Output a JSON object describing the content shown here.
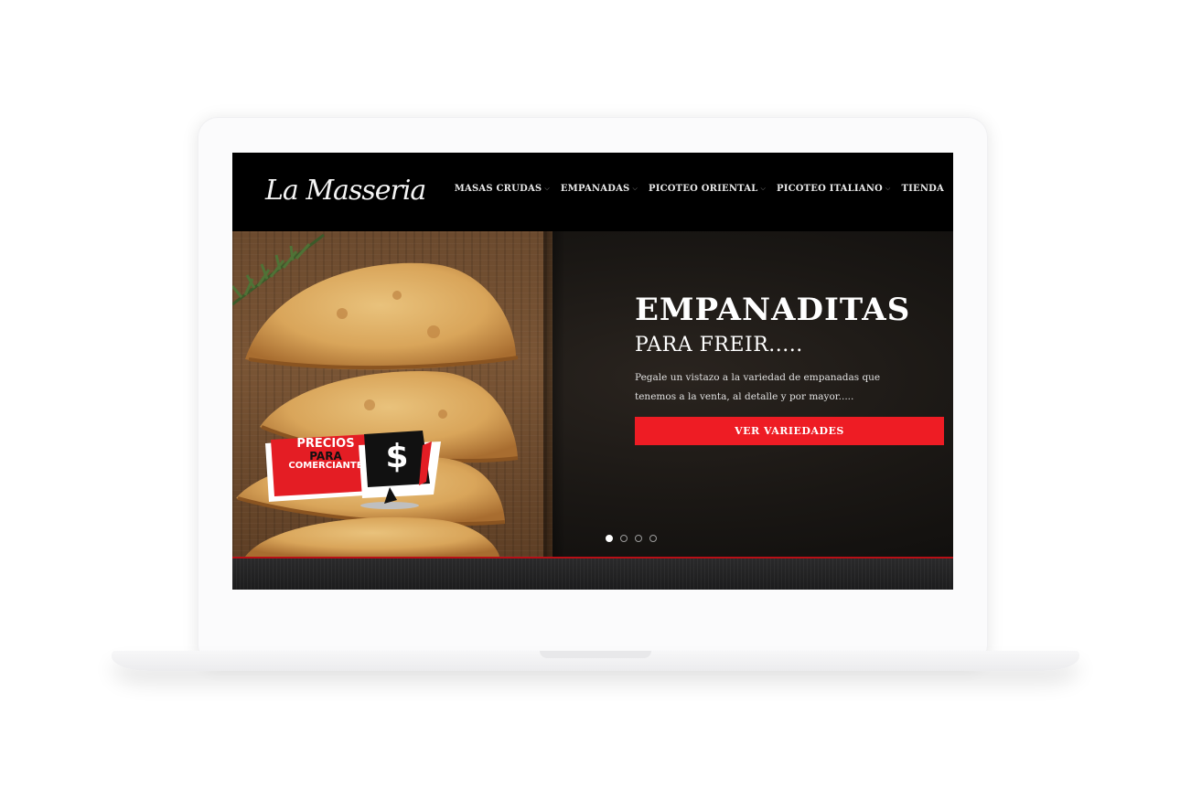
{
  "site": {
    "logo_text": "La Masseria",
    "nav": [
      {
        "label": "MASAS CRUDAS",
        "has_dropdown": true
      },
      {
        "label": "EMPANADAS",
        "has_dropdown": true
      },
      {
        "label": "PICOTEO ORIENTAL",
        "has_dropdown": true
      },
      {
        "label": "PICOTEO ITALIANO",
        "has_dropdown": true
      },
      {
        "label": "TIENDA",
        "has_dropdown": false
      }
    ]
  },
  "hero": {
    "title": "EMPANADITAS",
    "subtitle": "PARA FREIR.....",
    "description": "Pegale un vistazo a la variedad de empanadas que tenemos a la venta, al detalle y por mayor.....",
    "cta_label": "VER VARIEDADES",
    "badge": {
      "line1": "PRECIOS",
      "line2": "PARA",
      "line3": "COMERCIANTE",
      "symbol": "$"
    },
    "slides": {
      "count": 4,
      "active_index": 0
    }
  },
  "colors": {
    "accent_red": "#ee1c24",
    "header_bg": "#000000",
    "dot_active": "#ffffff"
  },
  "icons": {
    "nav_dropdown": "chevron-down-icon"
  }
}
